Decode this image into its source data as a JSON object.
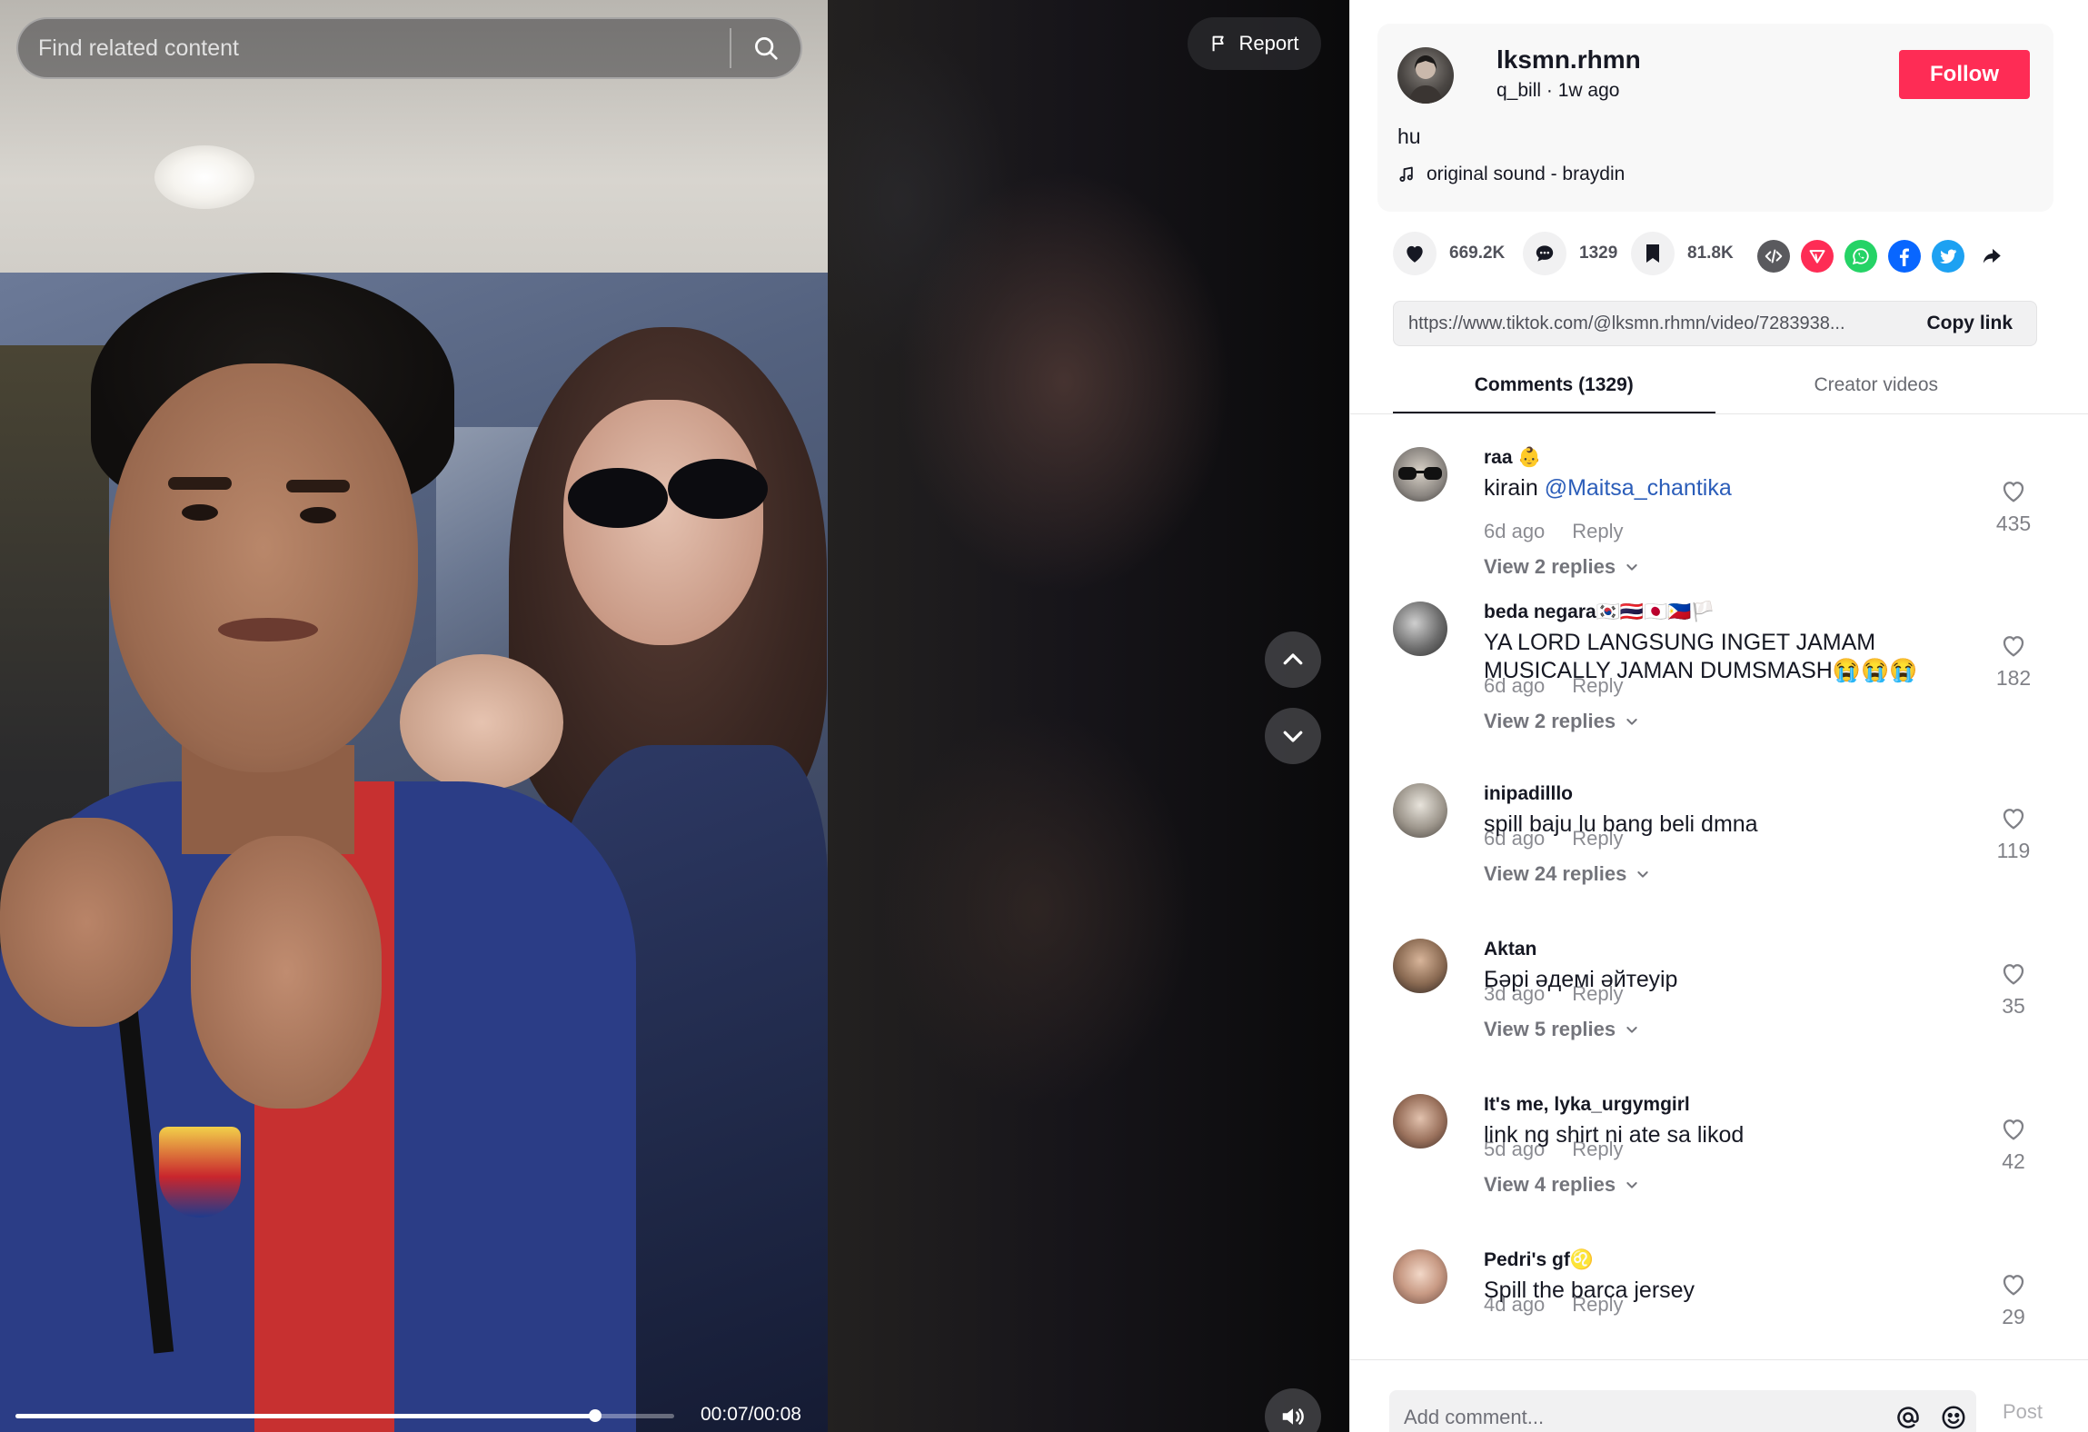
{
  "search": {
    "placeholder": "Find related content"
  },
  "report": {
    "label": "Report"
  },
  "player": {
    "time_display": "00:07/00:08",
    "progress_fraction": 0.88
  },
  "author": {
    "username": "lksmn.rhmn",
    "nickname": "q_bill",
    "posted": "1w ago",
    "follow_label": "Follow"
  },
  "video": {
    "description": "hu",
    "music": "original sound - braydin"
  },
  "actions": {
    "likes": "669.2K",
    "comments": "1329",
    "saves": "81.8K"
  },
  "share": {
    "icons": [
      "embed-icon",
      "send-to-friends-icon",
      "whatsapp-icon",
      "facebook-icon",
      "twitter-icon",
      "share-arrow-icon"
    ],
    "colors": {
      "embed": "#5a5a5e",
      "send": "#fe2c55",
      "whatsapp": "#25d366",
      "facebook": "#0866ff",
      "twitter": "#1da1f2"
    }
  },
  "link": {
    "url": "https://www.tiktok.com/@lksmn.rhmn/video/7283938...",
    "copy_label": "Copy link"
  },
  "tabs": [
    {
      "label": "Comments (1329)",
      "active": true
    },
    {
      "label": "Creator videos",
      "active": false
    }
  ],
  "comments": [
    {
      "user": "raa 👶",
      "text_plain": "kirain ",
      "mention": "@Maitsa_chantika",
      "age": "6d ago",
      "reply_label": "Reply",
      "view_replies": "View 2 replies",
      "likes": "435"
    },
    {
      "user": "beda negara🇰🇷🇹🇭🇯🇵🇵🇭🏳️",
      "text_plain": "YA LORD LANGSUNG INGET JAMAM MUSICALLY JAMAN DUMSMASH😭😭😭",
      "mention": "",
      "age": "6d ago",
      "reply_label": "Reply",
      "view_replies": "View 2 replies",
      "likes": "182"
    },
    {
      "user": "inipadilllo",
      "text_plain": "spill baju lu bang beli dmna",
      "mention": "",
      "age": "6d ago",
      "reply_label": "Reply",
      "view_replies": "View 24 replies",
      "likes": "119"
    },
    {
      "user": "Aktan",
      "text_plain": "Бәрі әдемі әйтеуір",
      "mention": "",
      "age": "3d ago",
      "reply_label": "Reply",
      "view_replies": "View 5 replies",
      "likes": "35"
    },
    {
      "user": "It's me, lyka_urgymgirl",
      "text_plain": "link ng shirt ni ate sa likod",
      "mention": "",
      "age": "5d ago",
      "reply_label": "Reply",
      "view_replies": "View 4 replies",
      "likes": "42"
    },
    {
      "user": "Pedri's gf♌",
      "text_plain": "Spill the barca jersey",
      "mention": "",
      "age": "4d ago",
      "reply_label": "Reply",
      "view_replies": "",
      "likes": "29"
    }
  ],
  "comment_input": {
    "placeholder": "Add comment...",
    "post_label": "Post"
  },
  "colors": {
    "follow": "#fe2c55",
    "mention": "#2b5db9"
  }
}
